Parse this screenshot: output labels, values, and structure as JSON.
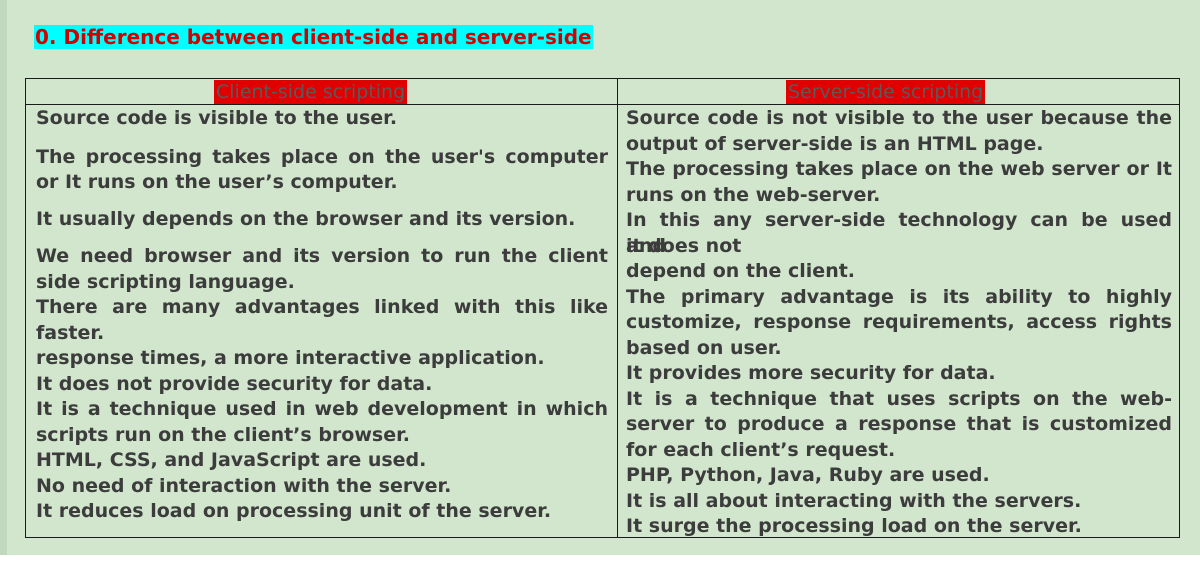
{
  "heading": "0. Difference between client-side and server-side",
  "table": {
    "headers": [
      "Client-side scripting",
      "Server-side scripting"
    ],
    "left": [
      "Source code is visible to the user.",
      "The processing takes place on the user's computer",
      "or It runs on the user’s computer.",
      "It usually depends on the browser and its version.",
      "We need browser and its version to run the client",
      "side scripting language.",
      "There are many advantages linked with this like",
      "faster.",
      "response times, a more interactive application.",
      "It does not provide security for data.",
      "It is a technique used in web development in which",
      "scripts run on the client’s browser.",
      "HTML, CSS, and JavaScript are used.",
      "No need of interaction with the server.",
      "It reduces load on processing unit of the server."
    ],
    "right": [
      "Source code is not visible to the user because the",
      "output of server-side  is an HTML page.",
      "The processing takes place on the web server or It",
      "runs on the web-server.",
      "In this any server-side technology can be used and",
      "it does not",
      "depend on the client.",
      "The primary advantage is its ability to highly",
      "customize, response requirements, access rights",
      "based on user.",
      "It provides more security for data.",
      "It is a technique that uses scripts on the web-",
      "server to produce a response that is customized",
      "for each client’s request.",
      "PHP, Python, Java, Ruby are used.",
      "It is all about interacting with the servers.",
      "It surge the processing load on the server."
    ]
  }
}
